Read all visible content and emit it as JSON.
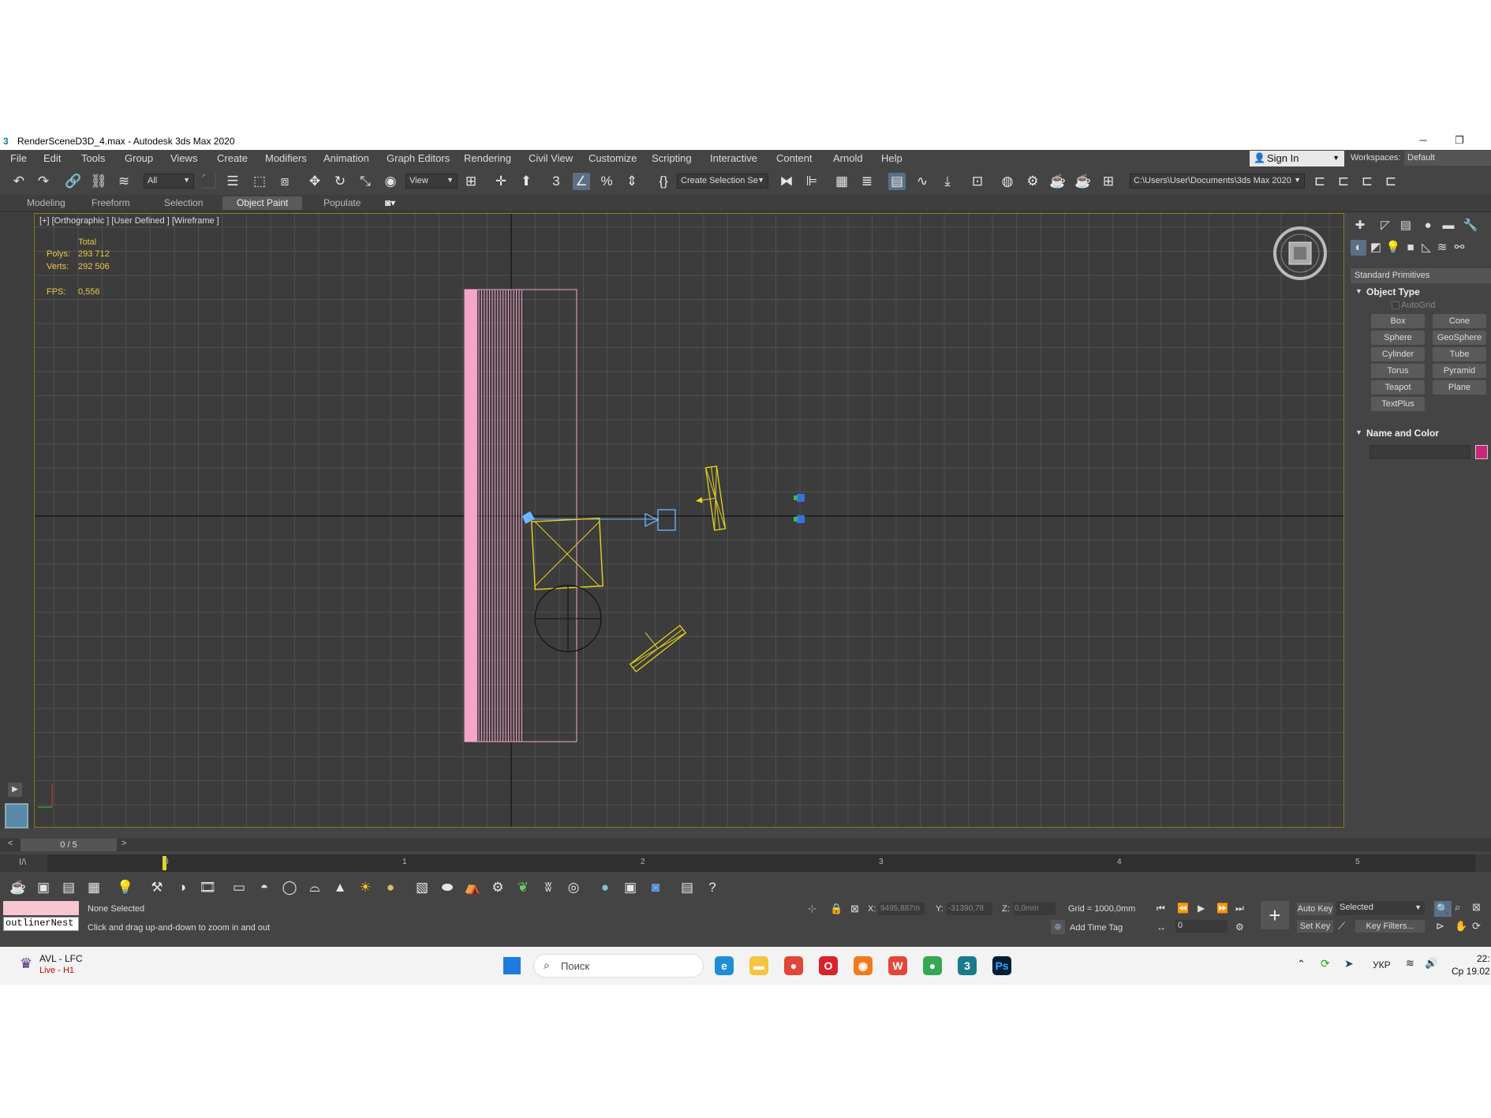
{
  "window": {
    "app_icon": "3",
    "title": "RenderSceneD3D_4.max - Autodesk 3ds Max 2020",
    "minimize": "─",
    "maximize": "❐"
  },
  "menubar": {
    "items": [
      "File",
      "Edit",
      "Tools",
      "Group",
      "Views",
      "Create",
      "Modifiers",
      "Animation",
      "Graph Editors",
      "Rendering",
      "Civil View",
      "Customize",
      "Scripting",
      "Interactive",
      "Content",
      "Arnold",
      "Help"
    ],
    "signin": "Sign In",
    "workspaces_label": "Workspaces:",
    "workspace_value": "Default"
  },
  "toolbar": {
    "filter_value": "All",
    "refcoord_value": "View",
    "selection_set_value": "Create Selection Se",
    "project_path": "C:\\Users\\User\\Documents\\3ds Max 2020"
  },
  "ribbon": {
    "tabs": [
      "Modeling",
      "Freeform",
      "Selection",
      "Object Paint",
      "Populate"
    ],
    "active_index": 3
  },
  "viewport": {
    "label": "[+] [Orthographic ] [User Defined ] [Wireframe ]",
    "stats": {
      "total_label": "Total",
      "polys_label": "Polys:",
      "polys_value": "293 712",
      "verts_label": "Verts:",
      "verts_value": "292 506",
      "fps_label": "FPS:",
      "fps_value": "0,556"
    },
    "colors": {
      "background": "#3c3c3c",
      "grid": "#4f4f4f",
      "pink": "#f3a6c8",
      "yellow": "#e6d420",
      "blue": "#6db7ff",
      "border": "#8a7a1e"
    },
    "viewcube_icon": "viewcube-icon"
  },
  "command_panel": {
    "category": "Standard Primitives",
    "object_type_title": "Object Type",
    "autogrid": "AutoGrid",
    "primitives": [
      "Box",
      "Cone",
      "Sphere",
      "GeoSphere",
      "Cylinder",
      "Tube",
      "Torus",
      "Pyramid",
      "Teapot",
      "Plane",
      "TextPlus"
    ],
    "name_color_title": "Name and Color",
    "object_color": "#c8287a"
  },
  "timeline": {
    "frame_counter": "0 / 5",
    "ticks": [
      "0",
      "1",
      "2",
      "3",
      "4",
      "5"
    ]
  },
  "status": {
    "maxscript_value": "outlinerNest",
    "selection": "None Selected",
    "prompt": "Click and drag up-and-down to zoom in and out",
    "x_label": "X:",
    "x_value": "9495,887m",
    "y_label": "Y:",
    "y_value": "-31390,78",
    "z_label": "Z:",
    "z_value": "0,0mm",
    "grid": "Grid = 1000,0mm",
    "add_time_tag": "Add Time Tag",
    "auto_key": "Auto Key",
    "set_key": "Set Key",
    "key_mode": "Selected",
    "key_filters": "Key Filters...",
    "frame_value": "0"
  },
  "taskbar": {
    "weather_title": "AVL - LFC",
    "weather_sub": "Live - H1",
    "search_placeholder": "Поиск",
    "language": "УКР",
    "time": "22:",
    "date": "Ср 19.02."
  }
}
